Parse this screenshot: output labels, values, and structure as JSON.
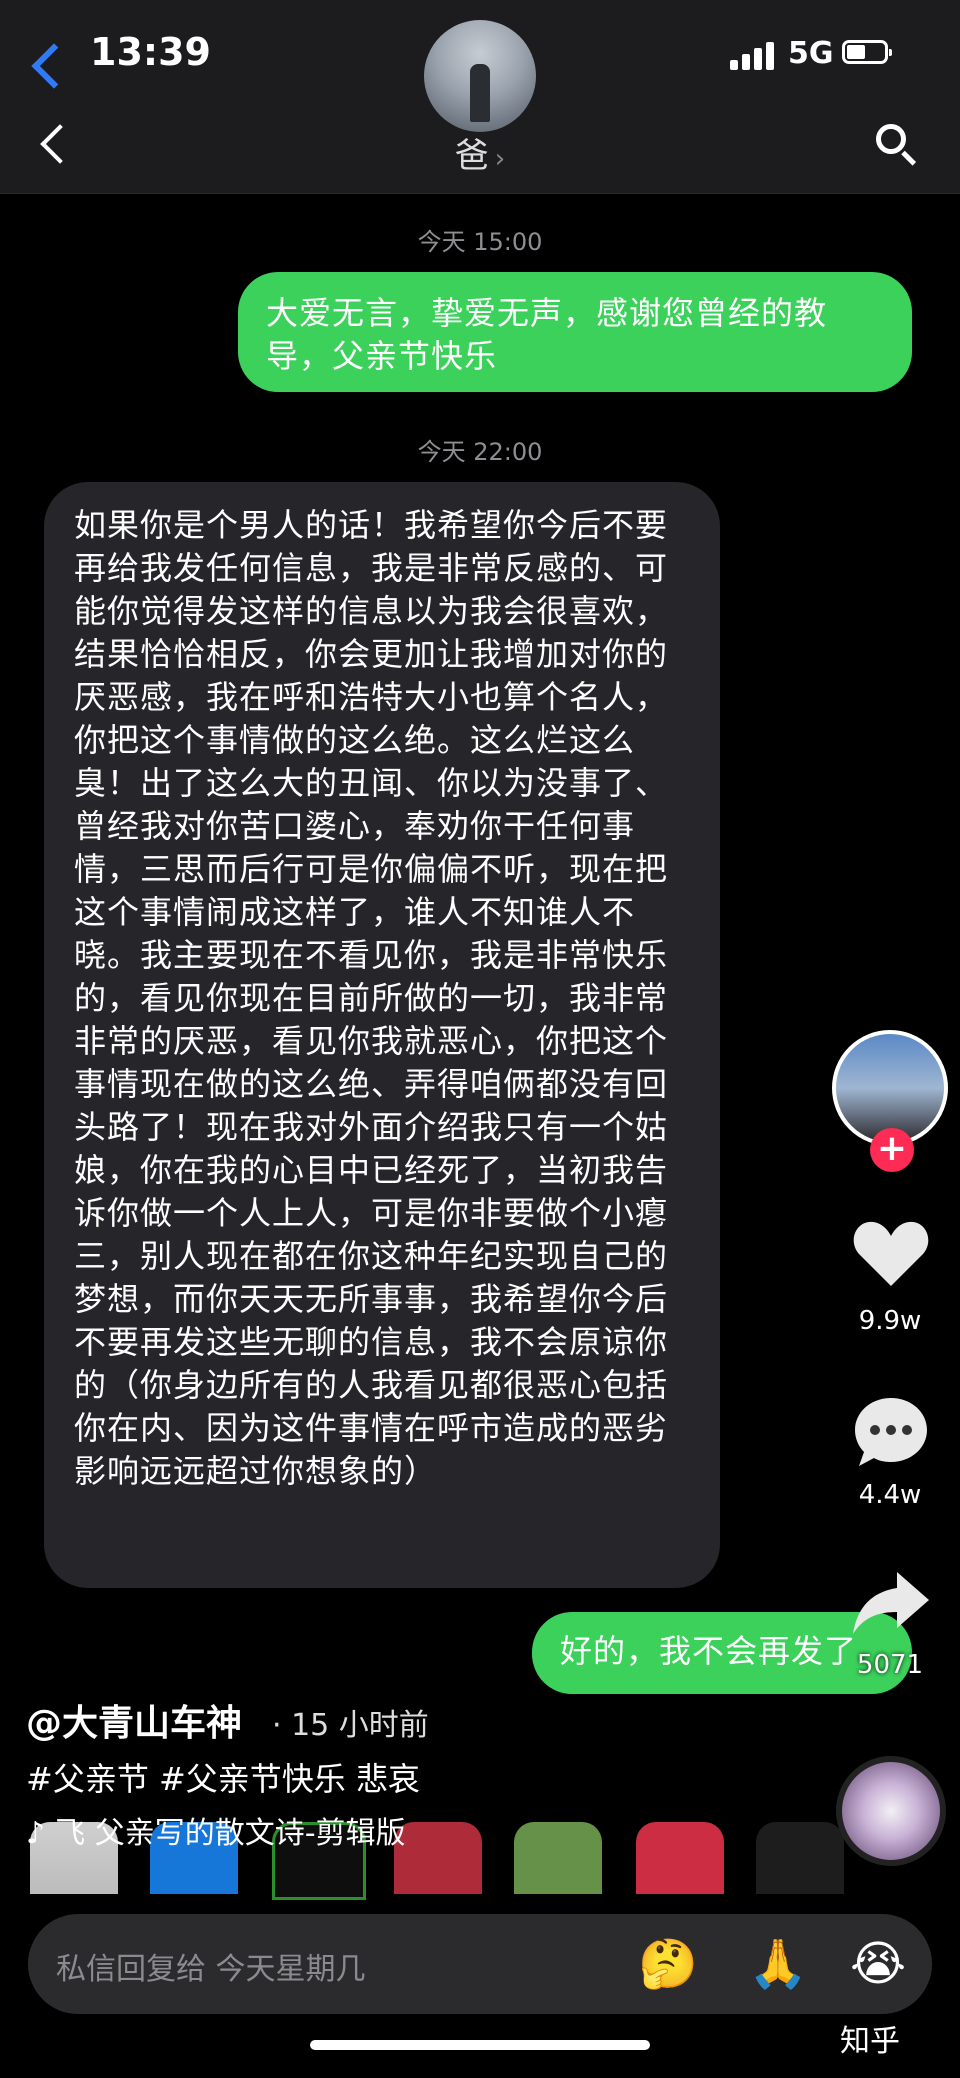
{
  "status_bar": {
    "time": "13:39",
    "network": "5G"
  },
  "contact": {
    "name": "爸",
    "chevron": "›"
  },
  "messages": [
    {
      "direction": "out",
      "timestamp": "今天 15:00",
      "text": "大爱无言，挚爱无声，感谢您曾经的教导，父亲节快乐"
    },
    {
      "direction": "in",
      "timestamp": "今天 22:00",
      "text": "如果你是个男人的话！我希望你今后不要再给我发任何信息，我是非常反感的、可能你觉得发这样的信息以为我会很喜欢，结果恰恰相反，你会更加让我增加对你的厌恶感，我在呼和浩特大小也算个名人，你把这个事情做的这么绝。这么烂这么臭！出了这么大的丑闻、你以为没事了、曾经我对你苦口婆心，奉劝你干任何事情，三思而后行可是你偏偏不听，现在把这个事情闹成这样了，谁人不知谁人不晓。我主要现在不看见你，我是非常快乐的，看见你现在目前所做的一切，我非常非常的厌恶，看见你我就恶心，你把这个事情现在做的这么绝、弄得咱俩都没有回头路了！现在我对外面介绍我只有一个姑娘，你在我的心目中已经死了，当初我告诉你做一个人上人，可是你非要做个小瘪三，别人现在都在你这种年纪实现自己的梦想，而你天天无所事事，我希望你今后不要再发这些无聊的信息，我不会原谅你的（你身边所有的人我看见都很恶心包括你在内、因为这件事情在呼市造成的恶劣影响远远超过你想象的）"
    },
    {
      "direction": "out",
      "text": "好的，我不会再发了"
    }
  ],
  "douyin": {
    "likes": "9.9w",
    "comments": "4.4w",
    "shares": "5071",
    "follow_symbol": "+",
    "username": "@大青山车神",
    "post_time": "· 15 小时前",
    "tags": "#父亲节 #父亲节快乐 悲哀",
    "music": "飞    父亲写的散文诗-剪辑版",
    "music_note": "♪"
  },
  "reply": {
    "placeholder": "私信回复给 今天星期几",
    "emojis": [
      "🤔",
      "🙏",
      "😭"
    ]
  },
  "watermark": "知乎",
  "colors": {
    "outgoing": "#3bd15a",
    "incoming": "#26262a",
    "accent": "#fe2c55",
    "ios_blue": "#2f7bf5"
  }
}
